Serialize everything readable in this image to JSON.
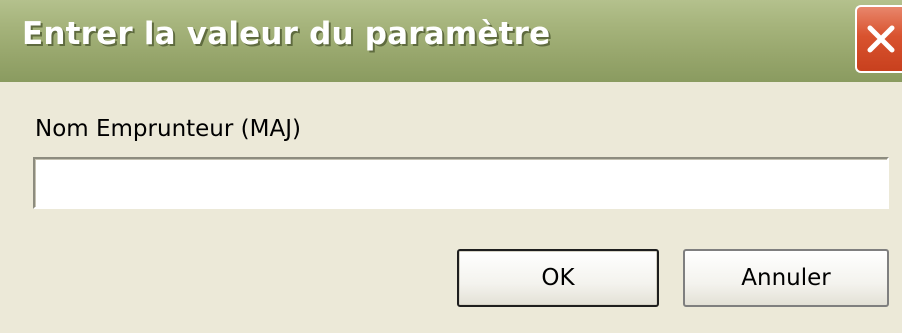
{
  "window": {
    "title": "Entrer la valeur du paramètre",
    "close_icon": "close-icon"
  },
  "form": {
    "field_label": "Nom Emprunteur (MAJ)",
    "field_value": "",
    "field_placeholder": ""
  },
  "buttons": {
    "ok_label": "OK",
    "cancel_label": "Annuler"
  },
  "colors": {
    "titlebar": "#a6b47c",
    "close_button": "#d9532f",
    "dialog_background": "#ece9d8"
  }
}
